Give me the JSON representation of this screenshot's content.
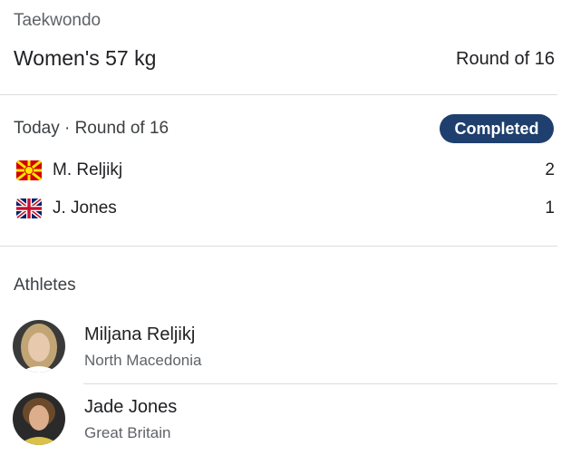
{
  "event": {
    "sport": "Taekwondo",
    "title": "Women's 57 kg",
    "round": "Round of 16"
  },
  "match": {
    "when": "Today · Round of 16",
    "status": "Completed",
    "status_color": "#1f3f6e",
    "competitors": [
      {
        "name": "M. Reljikj",
        "flag_icon": "north-macedonia-flag-icon",
        "score": "2"
      },
      {
        "name": "J. Jones",
        "flag_icon": "united-kingdom-flag-icon",
        "score": "1"
      }
    ]
  },
  "athletes": {
    "heading": "Athletes",
    "items": [
      {
        "name": "Miljana Reljikj",
        "country": "North Macedonia"
      },
      {
        "name": "Jade Jones",
        "country": "Great Britain"
      }
    ]
  }
}
